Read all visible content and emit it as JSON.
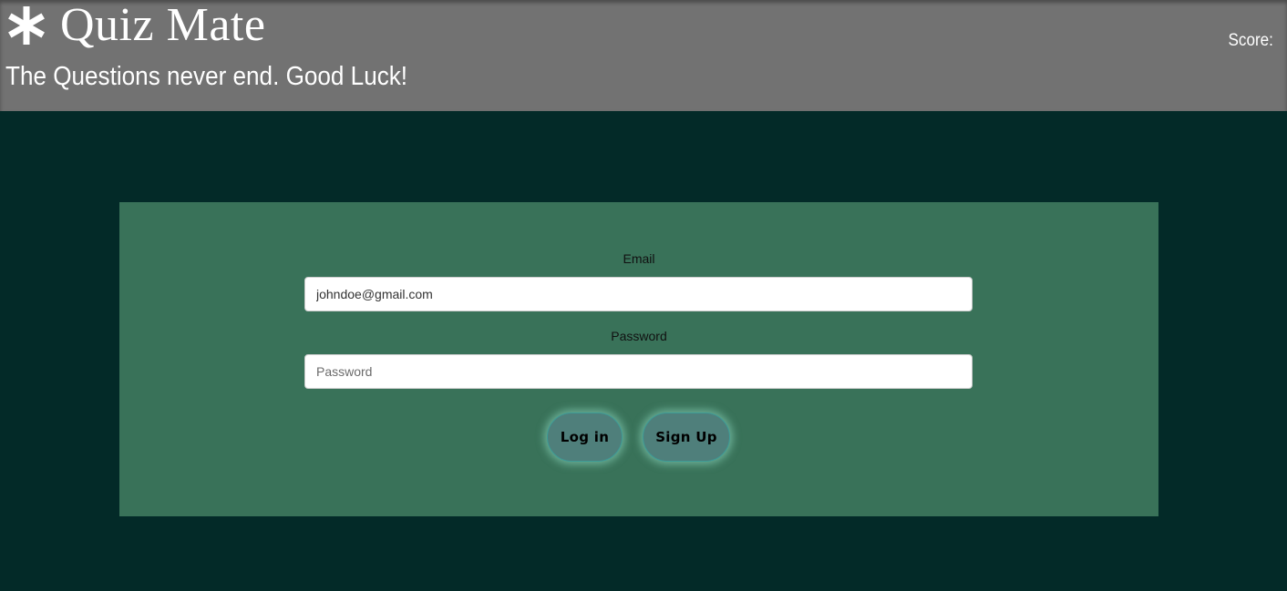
{
  "header": {
    "title": "Quiz Mate",
    "tagline": "The Questions never end. Good Luck!",
    "score_label": "Score:",
    "logo_icon": "asterisk-icon"
  },
  "login_form": {
    "email_label": "Email",
    "email_value": "johndoe@gmail.com",
    "password_label": "Password",
    "password_placeholder": "Password",
    "login_button": "Log in",
    "signup_button": "Sign Up"
  },
  "colors": {
    "background": "#032a28",
    "header": "#727272",
    "panel": "#397259",
    "button": "#4f7f7b"
  }
}
